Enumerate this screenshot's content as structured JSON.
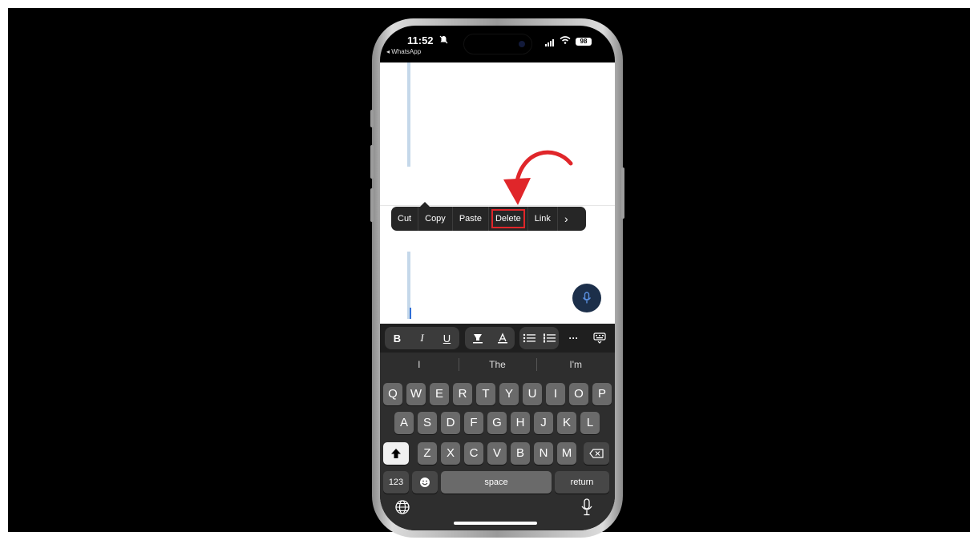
{
  "status_bar": {
    "time": "11:52",
    "back_app": "◂ WhatsApp",
    "battery": "98"
  },
  "context_menu": {
    "items": [
      "Cut",
      "Copy",
      "Paste",
      "Delete",
      "Link"
    ],
    "more": "›",
    "highlighted_item": "Delete",
    "highlight_color": "#e0262a"
  },
  "annotation": {
    "arrow_color": "#e0262a"
  },
  "toolbar": {
    "bold": "B",
    "italic": "I",
    "underline": "U",
    "more": "···",
    "icons": [
      "highlighter-icon",
      "text-color-icon",
      "bullet-list-icon",
      "numbered-list-icon",
      "keyboard-dismiss-icon"
    ]
  },
  "keyboard": {
    "suggestions": [
      "I",
      "The",
      "I'm"
    ],
    "row1": [
      "Q",
      "W",
      "E",
      "R",
      "T",
      "Y",
      "U",
      "I",
      "O",
      "P"
    ],
    "row2": [
      "A",
      "S",
      "D",
      "F",
      "G",
      "H",
      "J",
      "K",
      "L"
    ],
    "row3": [
      "Z",
      "X",
      "C",
      "V",
      "B",
      "N",
      "M"
    ],
    "numbers_label": "123",
    "space_label": "space",
    "return_label": "return"
  }
}
